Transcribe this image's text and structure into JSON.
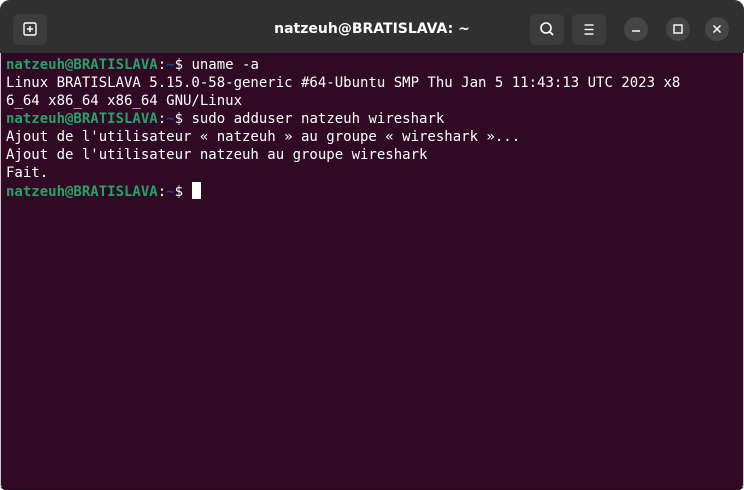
{
  "window": {
    "title": "natzeuh@BRATISLAVA: ~"
  },
  "titlebar": {
    "new_tab_icon": "new-tab-icon",
    "search_icon": "search-icon",
    "menu_icon": "hamburger-menu-icon",
    "minimize_icon": "minimize-icon",
    "maximize_icon": "maximize-icon",
    "close_icon": "close-icon"
  },
  "colors": {
    "terminal_bg": "#300a24",
    "prompt_user": "#26a269",
    "prompt_path": "#12488b",
    "titlebar_bg": "#303030"
  },
  "terminal": {
    "prompt_user": "natzeuh@BRATISLAVA",
    "prompt_sep": ":",
    "prompt_path": "~",
    "prompt_symbol": "$ ",
    "lines": [
      {
        "type": "prompt",
        "command": "uname -a"
      },
      {
        "type": "output",
        "text": "Linux BRATISLAVA 5.15.0-58-generic #64-Ubuntu SMP Thu Jan 5 11:43:13 UTC 2023 x8"
      },
      {
        "type": "output",
        "text": "6_64 x86_64 x86_64 GNU/Linux"
      },
      {
        "type": "prompt",
        "command": "sudo adduser natzeuh wireshark"
      },
      {
        "type": "output",
        "text": "Ajout de l'utilisateur « natzeuh » au groupe « wireshark »..."
      },
      {
        "type": "output",
        "text": "Ajout de l'utilisateur natzeuh au groupe wireshark"
      },
      {
        "type": "output",
        "text": "Fait."
      },
      {
        "type": "prompt",
        "command": ""
      }
    ]
  }
}
